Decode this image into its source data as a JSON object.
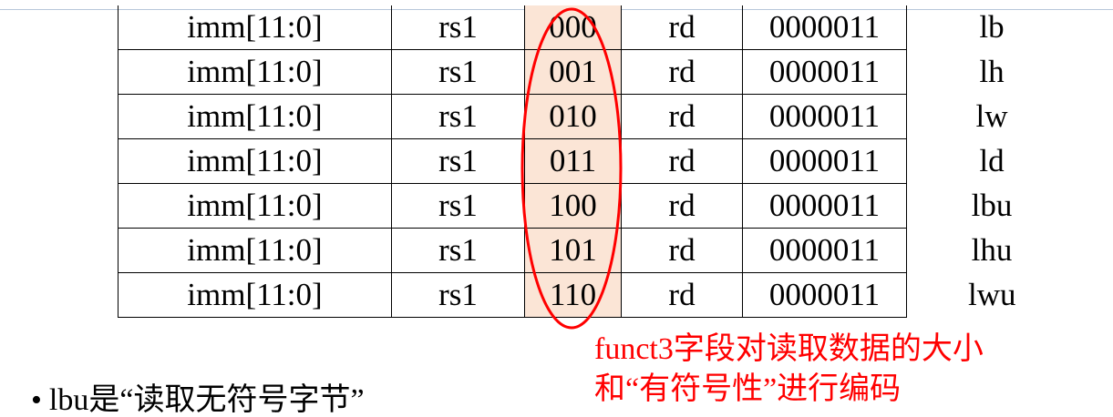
{
  "table": {
    "rows": [
      {
        "imm": "imm[11:0]",
        "rs1": "rs1",
        "funct3": "000",
        "rd": "rd",
        "opcode": "0000011",
        "mnemonic": "lb"
      },
      {
        "imm": "imm[11:0]",
        "rs1": "rs1",
        "funct3": "001",
        "rd": "rd",
        "opcode": "0000011",
        "mnemonic": "lh"
      },
      {
        "imm": "imm[11:0]",
        "rs1": "rs1",
        "funct3": "010",
        "rd": "rd",
        "opcode": "0000011",
        "mnemonic": "lw"
      },
      {
        "imm": "imm[11:0]",
        "rs1": "rs1",
        "funct3": "011",
        "rd": "rd",
        "opcode": "0000011",
        "mnemonic": "ld"
      },
      {
        "imm": "imm[11:0]",
        "rs1": "rs1",
        "funct3": "100",
        "rd": "rd",
        "opcode": "0000011",
        "mnemonic": "lbu"
      },
      {
        "imm": "imm[11:0]",
        "rs1": "rs1",
        "funct3": "101",
        "rd": "rd",
        "opcode": "0000011",
        "mnemonic": "lhu"
      },
      {
        "imm": "imm[11:0]",
        "rs1": "rs1",
        "funct3": "110",
        "rd": "rd",
        "opcode": "0000011",
        "mnemonic": "lwu"
      }
    ],
    "highlight_fill": "#fbe5d6"
  },
  "annotation": {
    "line1": "funct3字段对读取数据的大小",
    "line2": "和“有符号性”进行编码",
    "color": "#ff0000"
  },
  "bullet": {
    "marker": "•",
    "text": "lbu是“读取无符号字节”"
  }
}
